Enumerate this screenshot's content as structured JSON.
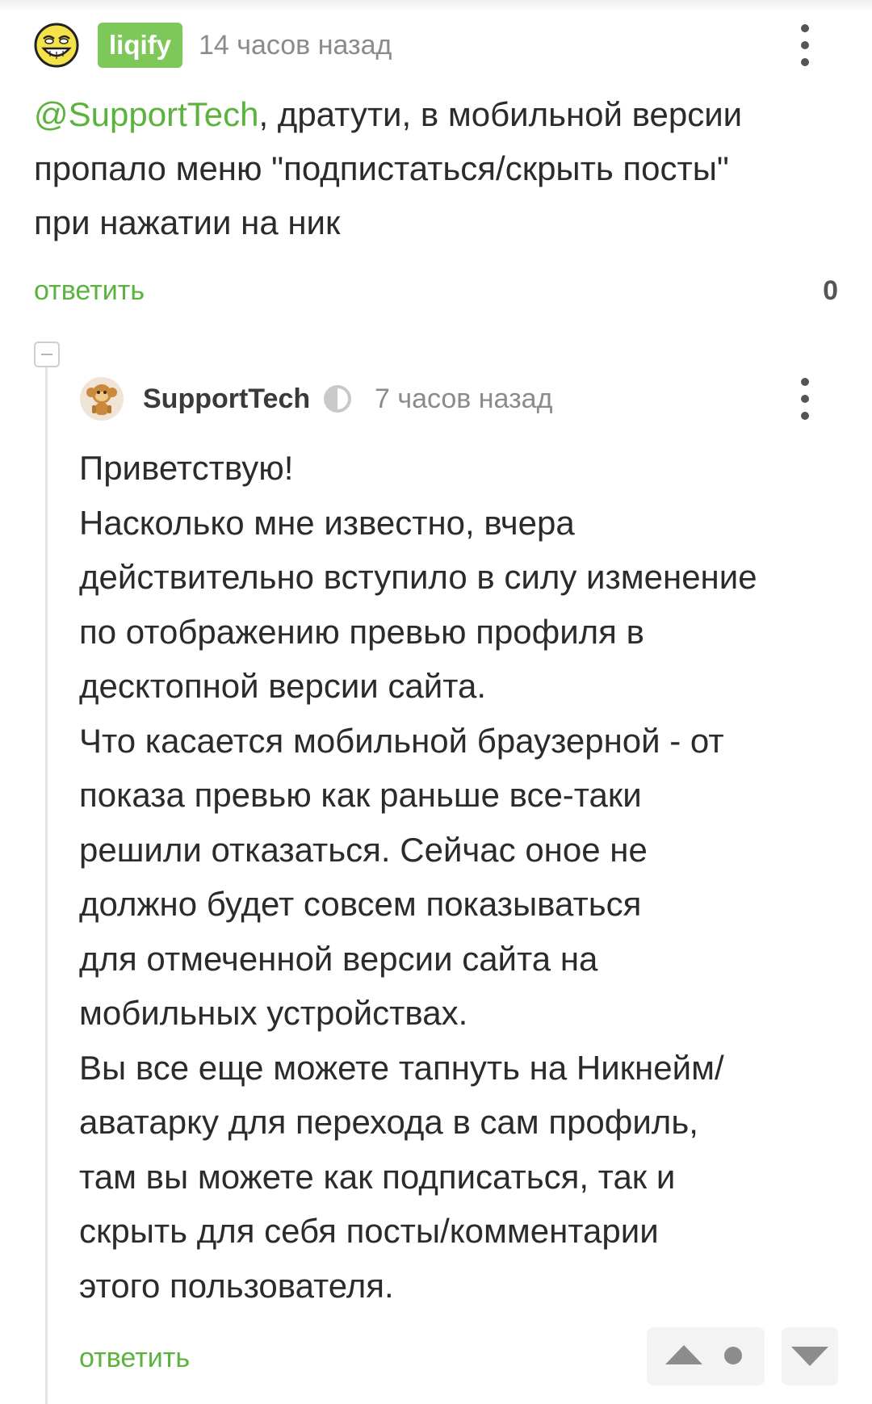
{
  "comment1": {
    "author": "liqify",
    "time": "14 часов назад",
    "mention": "@SupportTech",
    "text_lines": [
      ", дратути, в мобильной версии",
      "пропало меню \"подпистаться/скрыть посты\"",
      "при нажатии на ник"
    ],
    "reply_label": "ответить",
    "score": "0",
    "avatar_icon": "troll-face-icon",
    "menu_icon": "more-vertical-icon"
  },
  "comment2": {
    "author": "SupportTech",
    "time": "7 часов назад",
    "author_icon": "half-circle-badge-icon",
    "avatar_icon": "monkey-avatar-icon",
    "menu_icon": "more-vertical-icon",
    "text_lines": [
      "Приветствую!",
      "Насколько мне известно, вчера",
      "действительно вступило в силу изменение",
      "по отображению превью профиля в",
      "десктопной версии сайта.",
      "Что касается мобильной браузерной - от",
      "показа превью как раньше все-таки",
      "решили отказаться. Сейчас оное не",
      "должно будет совсем показываться",
      "для отмеченной версии сайта на",
      "мобильных устройствах.",
      "Вы все еще можете тапнуть на Никнейм/",
      "аватарку для перехода в сам профиль,",
      "там вы можете как подписаться, так и",
      "скрыть для себя посты/комментарии",
      "этого пользователя."
    ],
    "reply_label": "ответить"
  },
  "vote": {
    "up_icon": "upvote-triangle-icon",
    "neutral_icon": "score-dot-icon",
    "down_icon": "downvote-triangle-icon"
  },
  "thread": {
    "collapse_icon": "collapse-minus-icon"
  },
  "colors": {
    "accent_green": "#5ab33d",
    "badge_green": "#7ec85a",
    "muted_text": "#8b8b8b",
    "body_text": "#2b2b2b"
  }
}
